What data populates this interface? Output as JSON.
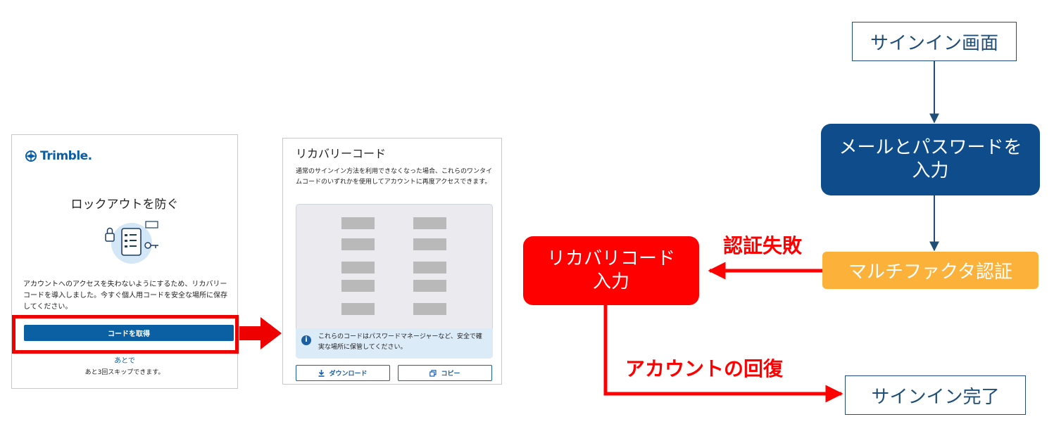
{
  "panel1": {
    "logo_text": "Trimble.",
    "title": "ロックアウトを防ぐ",
    "description": "アカウントへのアクセスを失わないようにするため、リカバリーコードを導入しました。今すぐ個人用コードを安全な場所に保存してください。",
    "get_code_button": "コードを取得",
    "later_link": "あとで",
    "skip_text": "あと3回スキップできます。"
  },
  "panel2": {
    "title": "リカバリーコード",
    "description": "通常のサインイン方法を利用できなくなった場合、これらのワンタイムコードのいずれかを使用してアカウントに再度アクセスできます。",
    "info_text": "これらのコードはパスワードマネージャーなど、安全で確実な場所に保管してください。",
    "download_button": "ダウンロード",
    "copy_button": "コピー"
  },
  "flow": {
    "signin_screen": "サインイン画面",
    "email_password": "メールとパスワードを入力",
    "mfa": "マルチファクタ認証",
    "recovery_code_input": "リカバリコード入力",
    "signin_complete": "サインイン完了",
    "auth_failed": "認証失敗",
    "account_recovery": "アカウントの回復"
  },
  "colors": {
    "trimble_blue": "#0b5fa3",
    "flow_navy": "#0e4c8c",
    "mfa_orange": "#fcb23a",
    "alert_red": "#ff0000",
    "outline_blue": "#1f4e79"
  }
}
